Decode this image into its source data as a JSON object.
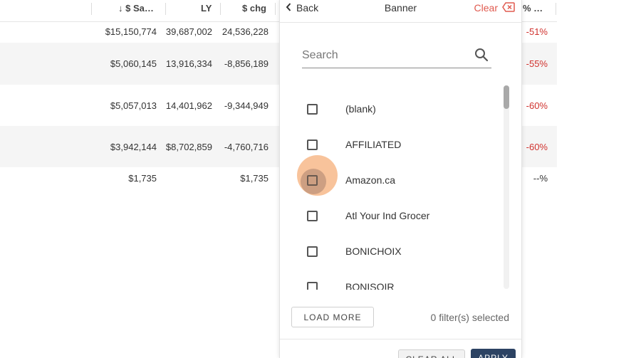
{
  "table": {
    "headers": {
      "sales": "↓ $ Sa…",
      "ly": "LY",
      "chg": "$ chg",
      "pct": "% …"
    },
    "rows": [
      {
        "sales": "$15,150,774",
        "ly": "39,687,002",
        "chg": "24,536,228",
        "pct": "-51%"
      },
      {
        "sales": "$5,060,145",
        "ly": "13,916,334",
        "chg": "-8,856,189",
        "pct": "-55%"
      },
      {
        "sales": "$5,057,013",
        "ly": "14,401,962",
        "chg": "-9,344,949",
        "pct": "-60%"
      },
      {
        "sales": "$3,942,144",
        "ly": "$8,702,859",
        "chg": "-4,760,716",
        "pct": "-60%"
      },
      {
        "sales": "$1,735",
        "ly": "",
        "chg": "$1,735",
        "pct": "--%"
      }
    ]
  },
  "panel": {
    "back_label": "Back",
    "title": "Banner",
    "clear_label": "Clear",
    "search": {
      "placeholder": "Search",
      "value": ""
    },
    "items": [
      {
        "label": "(blank)",
        "checked": false
      },
      {
        "label": "AFFILIATED",
        "checked": false
      },
      {
        "label": "Amazon.ca",
        "checked": false
      },
      {
        "label": "Atl Your Ind Grocer",
        "checked": false
      },
      {
        "label": "BONICHOIX",
        "checked": false
      },
      {
        "label": "BONISOIR",
        "checked": false
      }
    ],
    "load_more_label": "LOAD MORE",
    "filters_selected": "0 filter(s) selected",
    "clear_all_label": "CLEAR ALL",
    "apply_label": "APPLY"
  },
  "colors": {
    "negative": "#d0322e",
    "clear_accent": "#e05a4f",
    "apply_bg": "#2c4363",
    "ripple": "#f39248"
  }
}
